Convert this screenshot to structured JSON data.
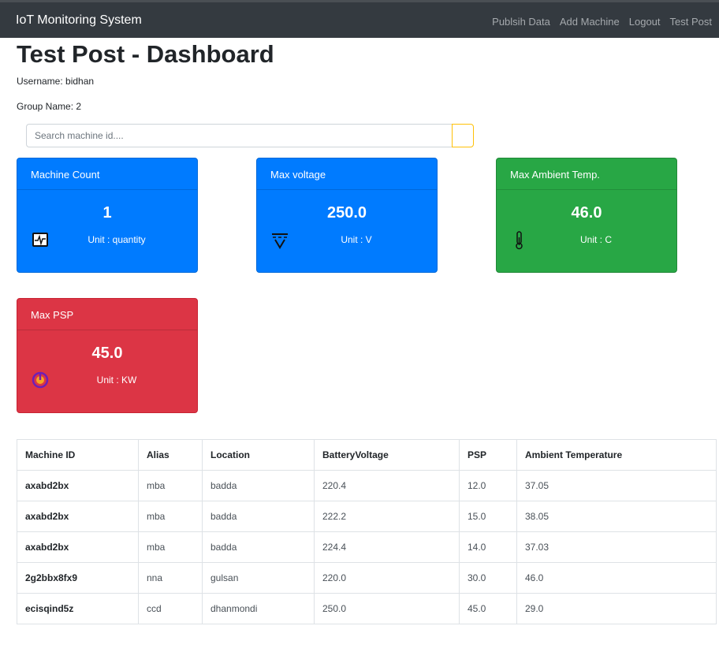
{
  "navbar": {
    "brand": "IoT Monitoring System",
    "links": [
      "Publsih Data",
      "Add Machine",
      "Logout",
      "Test Post"
    ]
  },
  "page": {
    "title": "Test Post - Dashboard",
    "username": "Username: bidhan",
    "group": "Group Name: 2"
  },
  "search": {
    "placeholder": "Search machine id...."
  },
  "cards": [
    {
      "title": "Machine Count",
      "value": "1",
      "unit": "Unit : quantity",
      "icon": "heartbeat-monitor-icon",
      "color": "#007bff"
    },
    {
      "title": "Max voltage",
      "value": "250.0",
      "unit": "Unit : V",
      "icon": "voltage-icon",
      "color": "#007bff"
    },
    {
      "title": "Max Ambient Temp.",
      "value": "46.0",
      "unit": "Unit : C",
      "icon": "thermometer-icon",
      "color": "#28a745"
    },
    {
      "title": "Max PSP",
      "value": "45.0",
      "unit": "Unit : KW",
      "icon": "power-icon",
      "color": "#dc3545"
    }
  ],
  "table": {
    "headers": [
      "Machine ID",
      "Alias",
      "Location",
      "BatteryVoltage",
      "PSP",
      "Ambient Temperature"
    ],
    "rows": [
      [
        "axabd2bx",
        "mba",
        "badda",
        "220.4",
        "12.0",
        "37.05"
      ],
      [
        "axabd2bx",
        "mba",
        "badda",
        "222.2",
        "15.0",
        "38.05"
      ],
      [
        "axabd2bx",
        "mba",
        "badda",
        "224.4",
        "14.0",
        "37.03"
      ],
      [
        "2g2bbx8fx9",
        "nna",
        "gulsan",
        "220.0",
        "30.0",
        "46.0"
      ],
      [
        "ecisqind5z",
        "ccd",
        "dhanmondi",
        "250.0",
        "45.0",
        "29.0"
      ]
    ]
  }
}
